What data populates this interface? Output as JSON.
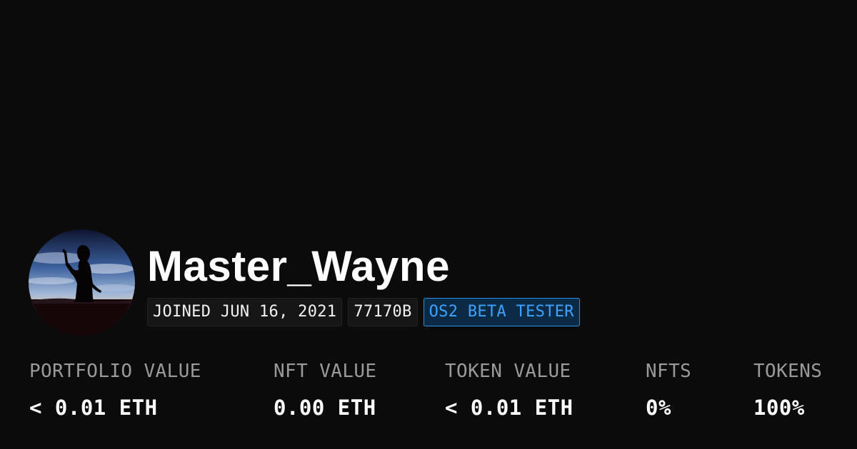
{
  "profile": {
    "avatar_icon": "silhouette-sunset-avatar-image",
    "username": "Master_Wayne",
    "badges": {
      "joined": "JOINED JUN 16, 2021",
      "address": "77170B",
      "tester": "OS2 BETA TESTER"
    }
  },
  "stats": [
    {
      "label": "PORTFOLIO VALUE",
      "value": "< 0.01 ETH"
    },
    {
      "label": "NFT VALUE",
      "value": "0.00 ETH"
    },
    {
      "label": "TOKEN VALUE",
      "value": "< 0.01 ETH"
    },
    {
      "label": "NFTS",
      "value": "0%"
    },
    {
      "label": "TOKENS",
      "value": "100%"
    }
  ],
  "colors": {
    "background": "#0b0b0b",
    "accent": "#3fa2ff",
    "label": "#9a9a9a"
  }
}
